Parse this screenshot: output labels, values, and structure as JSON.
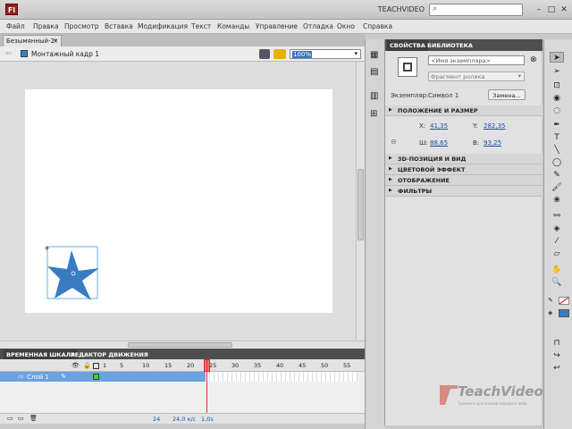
{
  "app": {
    "title": "TEACHVIDEO",
    "logo": "Fl"
  },
  "search": {
    "placeholder": ""
  },
  "menu": [
    "Файл",
    "Правка",
    "Просмотр",
    "Вставка",
    "Модификация",
    "Текст",
    "Команды",
    "Управление",
    "Отладка",
    "Окно",
    "Справка"
  ],
  "document": {
    "tab_title": "Безымянный-2*",
    "scene_label": "Монтажный кадр 1",
    "zoom": "100%"
  },
  "timeline": {
    "tabs": [
      "ВРЕМЕННАЯ ШКАЛА",
      "РЕДАКТОР ДВИЖЕНИЯ"
    ],
    "frame_numbers": [
      "1",
      "5",
      "10",
      "15",
      "20",
      "25",
      "30",
      "35",
      "40",
      "45",
      "50",
      "55"
    ],
    "layer_name": "Слой 1",
    "current_frame": "24",
    "fps": "24,0 к/с",
    "time": "1,0s"
  },
  "properties": {
    "tabs": [
      "СВОЙСТВА",
      "БИБЛИОТЕКА"
    ],
    "instance_name_placeholder": "<Имя экземпляра>",
    "symbol_type": "Фрагмент ролика",
    "instance_label": "Экземпляр:",
    "instance_value": "Символ 1",
    "swap_button": "Замена...",
    "position_section": "ПОЛОЖЕНИЕ И РАЗМЕР",
    "x_label": "X:",
    "x_value": "41,35",
    "y_label": "Y:",
    "y_value": "282,35",
    "w_label": "Ш:",
    "w_value": "88,65",
    "h_label": "В:",
    "h_value": "93,25",
    "sections": [
      "3D-ПОЗИЦИЯ И ВИД",
      "ЦВЕТОВОЙ ЭФФЕКТ",
      "ОТОБРАЖЕНИЕ",
      "ФИЛЬТРЫ"
    ]
  },
  "watermark": {
    "brand": "TeachVideo",
    "tagline": "Тренинги для знаний мирового веба"
  },
  "colors": {
    "accent": "#3e7fc0",
    "selection": "#6aa3e0",
    "playhead": "#e05050",
    "star_fill": "#3a7cc4"
  }
}
